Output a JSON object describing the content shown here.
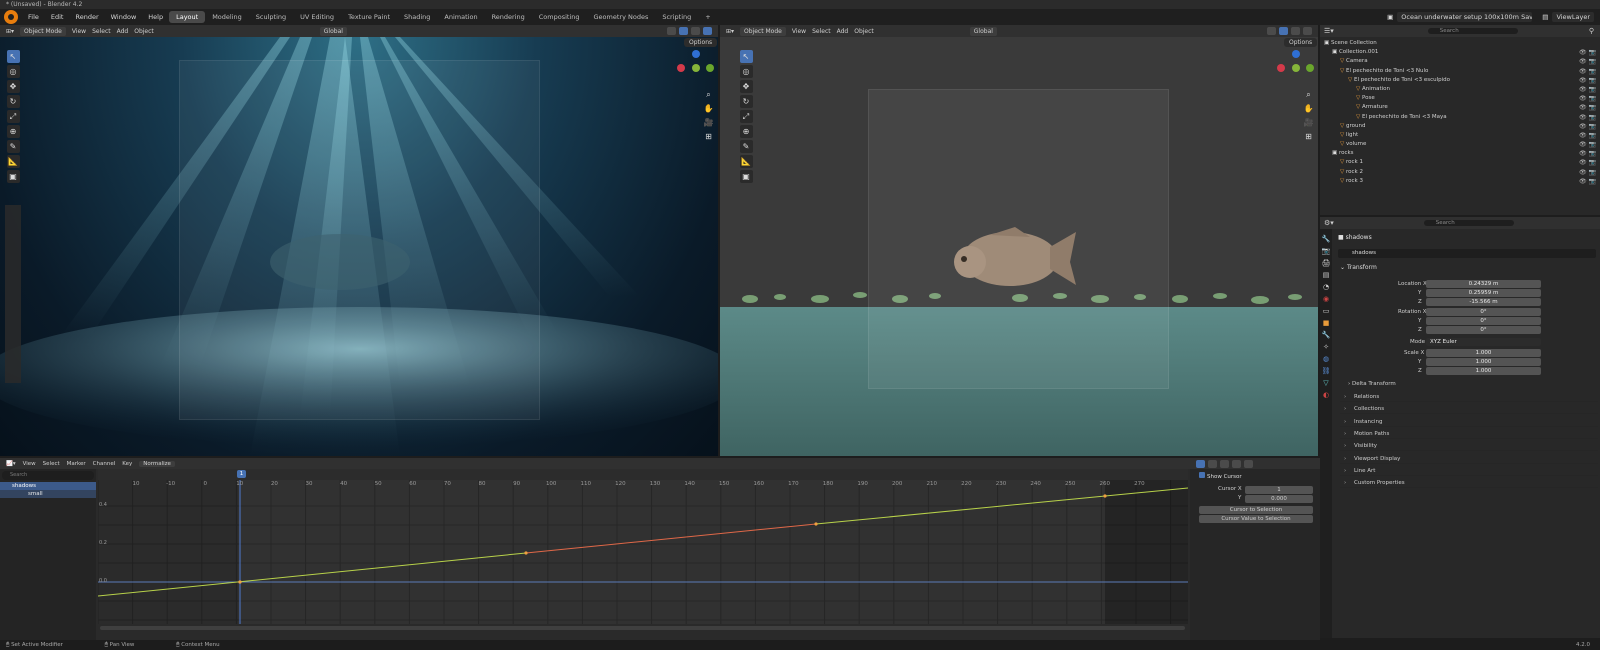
{
  "title_bar": {
    "text": "* (Unsaved) - Blender 4.2"
  },
  "menu": [
    "File",
    "Edit",
    "Render",
    "Window",
    "Help"
  ],
  "workspaces": [
    "Layout",
    "Modeling",
    "Sculpting",
    "UV Editing",
    "Texture Paint",
    "Shading",
    "Animation",
    "Rendering",
    "Compositing",
    "Geometry Nodes",
    "Scripting"
  ],
  "workspace_plus": "+",
  "active_workspace": "Layout",
  "scene": {
    "name": "Ocean underwater setup 100x100m Saves",
    "view_layer": "ViewLayer"
  },
  "viewport_left": {
    "mode": "Object Mode",
    "menus": [
      "View",
      "Select",
      "Add",
      "Object"
    ],
    "transform": "Global",
    "options": "Options"
  },
  "viewport_right": {
    "mode": "Object Mode",
    "menus": [
      "View",
      "Select",
      "Add",
      "Object"
    ],
    "transform": "Global",
    "options": "Options"
  },
  "outliner": {
    "search_placeholder": "Search",
    "rows": [
      {
        "label": "Scene Collection",
        "indent": 0
      },
      {
        "label": "Collection.001",
        "indent": 1
      },
      {
        "label": "Camera",
        "indent": 2
      },
      {
        "label": "El pechechito de Toni <3 Nulo",
        "indent": 2
      },
      {
        "label": "El pechechito de Toni <3 esculpido",
        "indent": 3
      },
      {
        "label": "Animation",
        "indent": 4
      },
      {
        "label": "Pose",
        "indent": 4
      },
      {
        "label": "Armature",
        "indent": 4
      },
      {
        "label": "El pechechito de Toni <3 Maya",
        "indent": 4
      },
      {
        "label": "ground",
        "indent": 2
      },
      {
        "label": "light",
        "indent": 2
      },
      {
        "label": "volume",
        "indent": 2
      },
      {
        "label": "rocks",
        "indent": 1
      },
      {
        "label": "rock 1",
        "indent": 2
      },
      {
        "label": "rock 2",
        "indent": 2
      },
      {
        "label": "rock 3",
        "indent": 2
      }
    ]
  },
  "properties": {
    "search_placeholder": "Search",
    "object_name": "shadows",
    "object_field": "shadows",
    "transform_header": "Transform",
    "location": {
      "label": "Location X",
      "x": "0.24329 m",
      "y_label": "Y",
      "y": "0.25959 m",
      "z_label": "Z",
      "z": "-15.566 m"
    },
    "rotation": {
      "label": "Rotation X",
      "x": "0°",
      "y_label": "Y",
      "y": "0°",
      "z_label": "Z",
      "z": "0°"
    },
    "mode": {
      "label": "Mode",
      "value": "XYZ Euler"
    },
    "scale": {
      "label": "Scale X",
      "x": "1.000",
      "y_label": "Y",
      "y": "1.000",
      "z_label": "Z",
      "z": "1.000"
    },
    "delta": "Delta Transform",
    "panels": [
      "Relations",
      "Collections",
      "Instancing",
      "Motion Paths",
      "Visibility",
      "Viewport Display",
      "Line Art",
      "Custom Properties"
    ]
  },
  "graph_editor": {
    "menus": [
      "View",
      "Select",
      "Marker",
      "Channel",
      "Key"
    ],
    "normalize": "Normalize",
    "search_placeholder": "Search",
    "channels": [
      "shadows",
      "small"
    ],
    "current_frame": "1",
    "ruler": [
      "10",
      "-10",
      "0",
      "10",
      "20",
      "30",
      "40",
      "50",
      "60",
      "70",
      "80",
      "90",
      "100",
      "110",
      "120",
      "130",
      "140",
      "150",
      "160",
      "170",
      "180",
      "190",
      "200",
      "210",
      "220",
      "230",
      "240",
      "250",
      "260",
      "270"
    ],
    "y_labels": [
      "0.4",
      "0.2",
      "0.0"
    ],
    "side_panel": {
      "show_cursor": "Show Cursor",
      "cursor_x_label": "Cursor X",
      "cursor_x": "1",
      "cursor_y_label": "Y",
      "cursor_y": "0.000",
      "btn1": "Cursor to Selection",
      "btn2": "Cursor Value to Selection"
    }
  },
  "status_bar": {
    "left": "Set Active Modifier",
    "middle": "Pan View",
    "right": "Context Menu",
    "version": "4.2.0"
  },
  "colors": {
    "accent": "#4772b3",
    "bg": "#1d1d1d",
    "header": "#303030"
  }
}
